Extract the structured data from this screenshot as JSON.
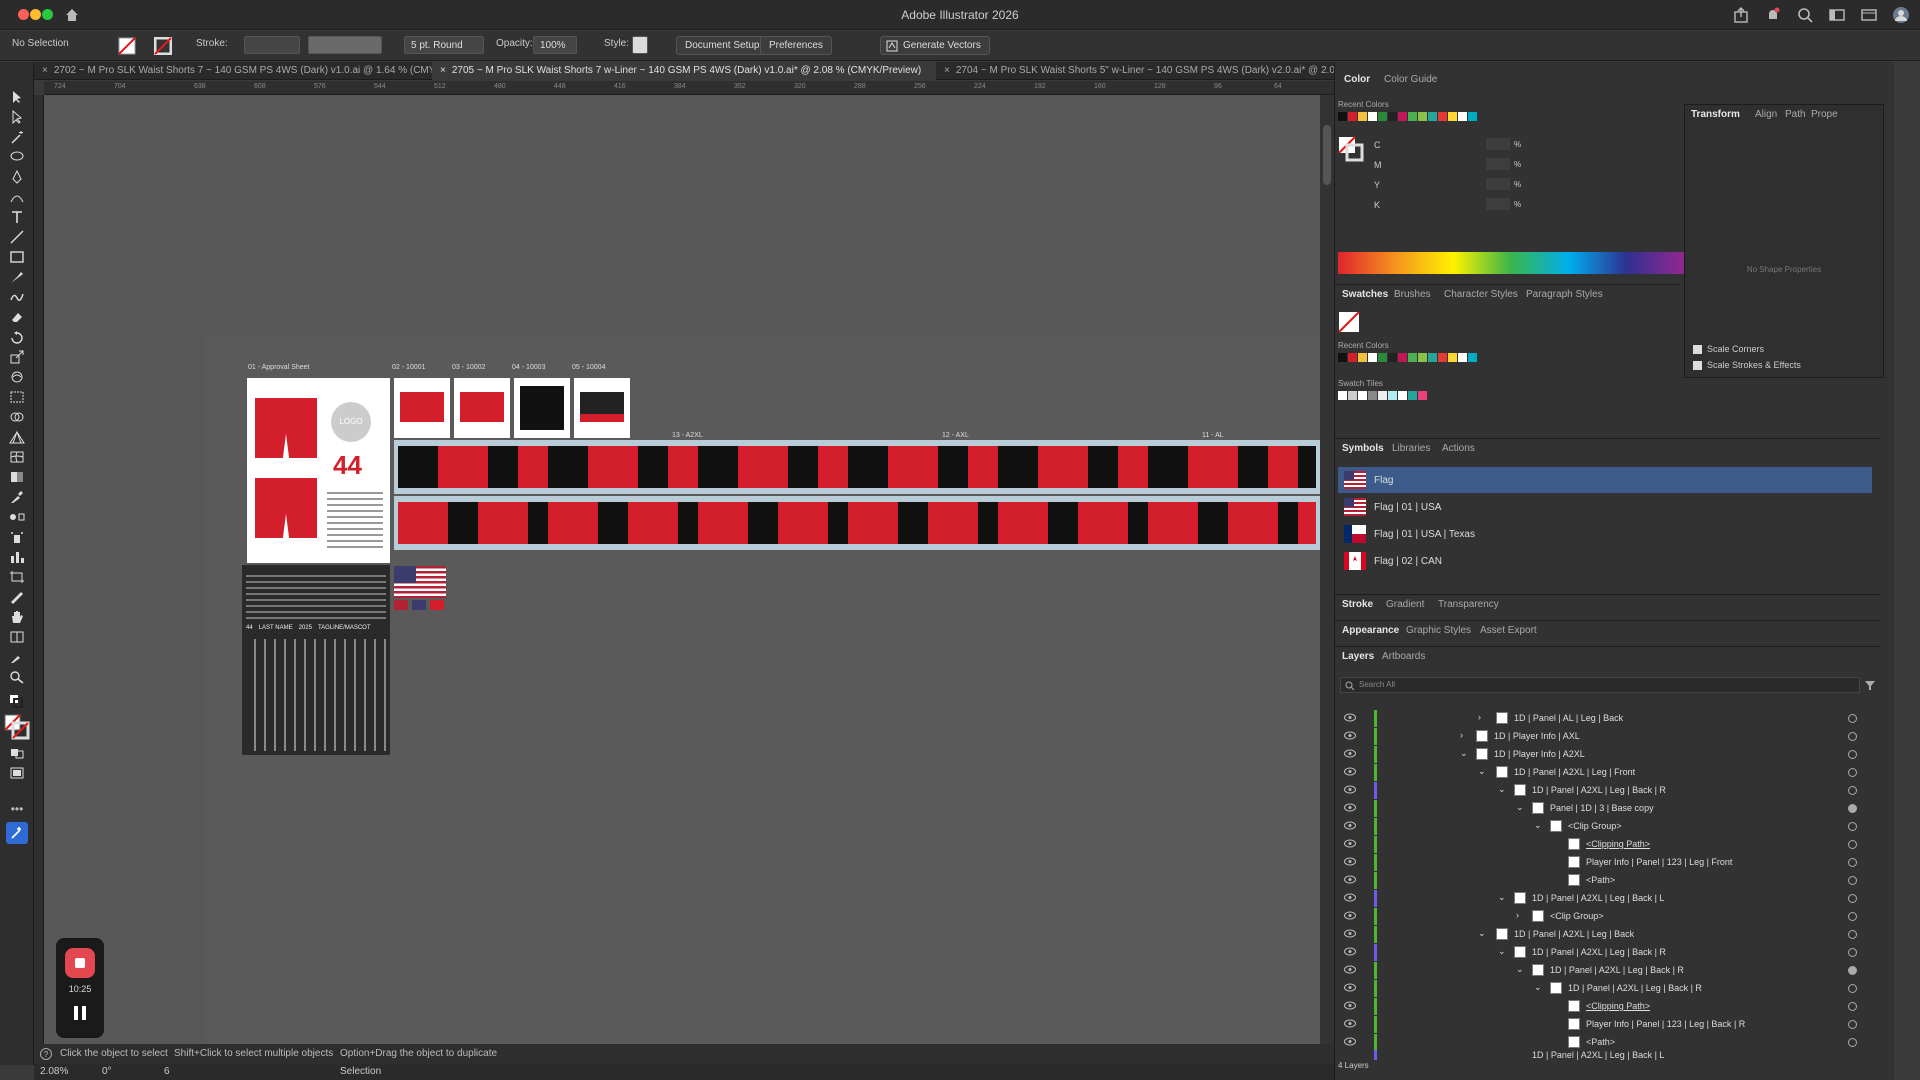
{
  "window": {
    "title": "Adobe Illustrator 2026"
  },
  "controlbar": {
    "selection": "No Selection",
    "stroke_label": "Stroke:",
    "brush": "5 pt. Round",
    "opacity_label": "Opacity:",
    "opacity_value": "100%",
    "style_label": "Style:",
    "document_setup": "Document Setup",
    "preferences": "Preferences",
    "generate_vectors": "Generate Vectors"
  },
  "tabs": [
    {
      "label": "2702 ~ M Pro SLK Waist Shorts 7 ~ 140 GSM PS 4WS (Dark) v1.0.ai @ 1.64 % (CMYK/Pr..."
    },
    {
      "label": "2705 ~ M Pro SLK Waist Shorts 7 w-Liner ~ 140 GSM PS 4WS (Dark) v1.0.ai* @ 2.08 % (CMYK/Preview)"
    },
    {
      "label": "2704 ~ M Pro SLK Waist Shorts 5\" w-Liner ~ 140 GSM PS 4WS (Dark) v2.0.ai* @ 2.08 ..."
    }
  ],
  "ruler_ticks": [
    "724",
    "704",
    "638",
    "608",
    "576",
    "544",
    "512",
    "480",
    "448",
    "416",
    "384",
    "352",
    "320",
    "288",
    "256",
    "224",
    "192",
    "160",
    "128",
    "96",
    "64"
  ],
  "artboards": {
    "labels": [
      "01 - Approval Sheet",
      "02 - 10001",
      "03 - 10002",
      "04 - 10003",
      "05 - 10004",
      "13 - A2XL",
      "12 - AXL",
      "11 - AL"
    ],
    "logo_text": "LOGO",
    "number": "44",
    "row_header": [
      "44",
      "LAST NAME",
      "2025",
      "TAGLINE/MASCOT"
    ]
  },
  "status": {
    "hint_click": "Click the object to select",
    "hint_shift": "Shift+Click to select multiple objects",
    "hint_option": "Option+Drag the object to duplicate",
    "zoom": "2.08%",
    "angle": "0°",
    "artboard_nav": "6",
    "mode": "Selection"
  },
  "recorder": {
    "time": "10:25"
  },
  "color_panel": {
    "tabs": [
      "Color",
      "Color Guide"
    ],
    "recent_label": "Recent Colors",
    "channels": [
      "C",
      "M",
      "Y",
      "K"
    ],
    "percent": "%"
  },
  "transform_panel": {
    "tabs": [
      "Transform",
      "Align",
      "Path",
      "Prope"
    ],
    "no_shape": "No Shape Properties",
    "scale_corners": "Scale Corners",
    "scale_strokes": "Scale Strokes & Effects"
  },
  "swatches_panel": {
    "tabs": [
      "Swatches",
      "Brushes",
      "Character Styles",
      "Paragraph Styles"
    ],
    "recent_label": "Recent Colors",
    "tiles_label": "Swatch Tiles"
  },
  "symbols_panel": {
    "tabs": [
      "Symbols",
      "Libraries",
      "Actions"
    ],
    "items": [
      {
        "label": "Flag"
      },
      {
        "label": "Flag | 01 | USA"
      },
      {
        "label": "Flag | 01 | USA | Texas"
      },
      {
        "label": "Flag | 02 | CAN"
      }
    ]
  },
  "stroke_tabs": [
    "Stroke",
    "Gradient",
    "Transparency"
  ],
  "appearance_tabs": [
    "Appearance",
    "Graphic Styles",
    "Asset Export"
  ],
  "layers_panel": {
    "tabs": [
      "Layers",
      "Artboards"
    ],
    "search_placeholder": "Search All",
    "count": "4 Layers",
    "rows": [
      {
        "label": "1D | Panel | AL | Leg | Back"
      },
      {
        "label": "1D | Player Info | AXL"
      },
      {
        "label": "1D | Player Info | A2XL"
      },
      {
        "label": "1D | Panel | A2XL | Leg | Front"
      },
      {
        "label": "1D | Panel | A2XL | Leg | Back | R"
      },
      {
        "label": "Panel | 1D | 3 | Base copy"
      },
      {
        "label": "<Clip Group>"
      },
      {
        "label": "<Clipping Path>"
      },
      {
        "label": "Player Info | Panel | 123 | Leg | Front"
      },
      {
        "label": "<Path>"
      },
      {
        "label": "1D | Panel | A2XL | Leg | Back | L"
      },
      {
        "label": "<Clip Group>"
      },
      {
        "label": "1D | Panel | A2XL | Leg | Back"
      },
      {
        "label": "1D | Panel | A2XL | Leg | Back | R"
      },
      {
        "label": "1D | Panel | A2XL | Leg | Back | R"
      },
      {
        "label": "1D | Panel | A2XL | Leg | Back | R"
      },
      {
        "label": "<Clipping Path>"
      },
      {
        "label": "Player Info | Panel | 123 | Leg | Back | R"
      },
      {
        "label": "<Path>"
      },
      {
        "label": "1D | Panel | A2XL | Leg | Back | L"
      }
    ]
  },
  "colors": {
    "accent_blue": "#2e6bd6",
    "selected_row": "#3c5a8a",
    "layer_green": "#4cb832",
    "shorts_red": "#d31f2b"
  }
}
